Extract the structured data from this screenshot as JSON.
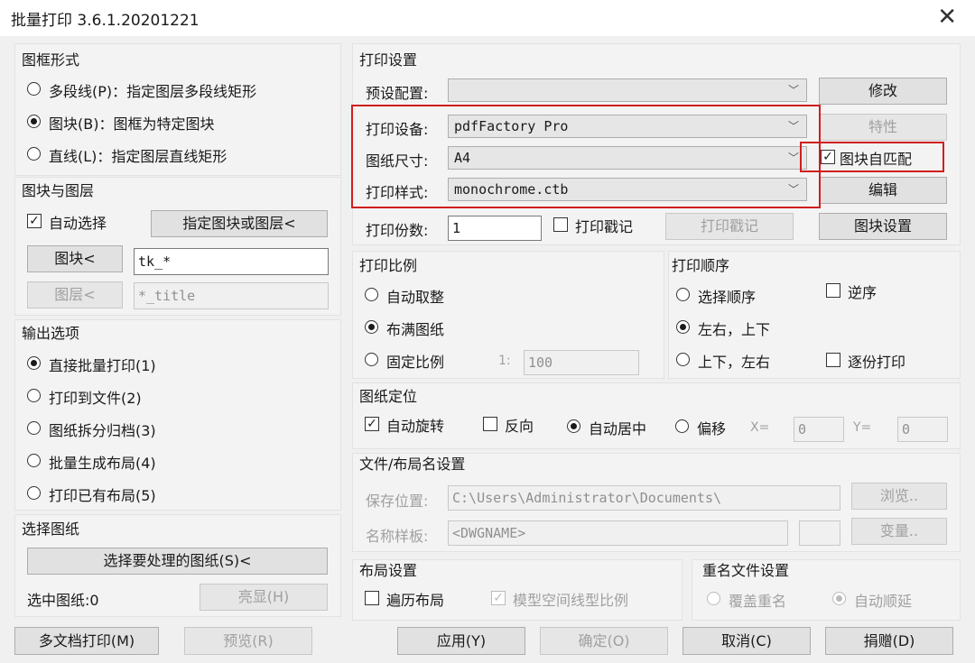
{
  "window": {
    "title": "批量打印 3.6.1.20201221",
    "close": "✕"
  },
  "frame_form": {
    "title": "图框形式",
    "options": [
      "多段线(P)：指定图层多段线矩形",
      "图块(B)：图框为特定图块",
      "直线(L)：指定图层直线矩形"
    ],
    "selected": 1
  },
  "block_layer": {
    "title": "图块与图层",
    "auto_select": "自动选择",
    "specify_btn": "指定图块或图层<",
    "block_btn": "图块<",
    "block_value": "tk_*",
    "layer_btn": "图层<",
    "layer_value": "*_title"
  },
  "output": {
    "title": "输出选项",
    "options": [
      "直接批量打印(1)",
      "打印到文件(2)",
      "图纸拆分归档(3)",
      "批量生成布局(4)",
      "打印已有布局(5)"
    ],
    "selected": 0
  },
  "select_drawing": {
    "title": "选择图纸",
    "select_btn": "选择要处理的图纸(S)<",
    "selected_label": "选中图纸:0",
    "highlight_btn": "亮显(H)"
  },
  "print_settings": {
    "title": "打印设置",
    "preset_label": "预设配置:",
    "preset_value": "",
    "modify_btn": "修改",
    "device_label": "打印设备:",
    "device_value": "pdfFactory Pro",
    "props_btn": "特性",
    "paper_label": "图纸尺寸:",
    "paper_value": "A4",
    "auto_match": "图块自匹配",
    "style_label": "打印样式:",
    "style_value": "monochrome.ctb",
    "edit_btn": "编辑",
    "copies_label": "打印份数:",
    "copies_value": "1",
    "stamp_check": "打印戳记",
    "stamp_btn": "打印戳记",
    "block_settings_btn": "图块设置"
  },
  "scale": {
    "title": "打印比例",
    "options": [
      "自动取整",
      "布满图纸",
      "固定比例"
    ],
    "selected": 1,
    "ratio_prefix": "1:",
    "ratio_value": "100"
  },
  "order": {
    "title": "打印顺序",
    "options": [
      "选择顺序",
      "左右，上下",
      "上下，左右"
    ],
    "selected": 1,
    "reverse": "逆序",
    "collate": "逐份打印"
  },
  "position": {
    "title": "图纸定位",
    "auto_rotate": "自动旋转",
    "reverse": "反向",
    "auto_center": "自动居中",
    "offset": "偏移",
    "x_label": "X=",
    "x_value": "0",
    "y_label": "Y=",
    "y_value": "0"
  },
  "file_naming": {
    "title": "文件/布局名设置",
    "save_label": "保存位置:",
    "save_value": "C:\\Users\\Administrator\\Documents\\",
    "browse_btn": "浏览..",
    "name_label": "名称样板:",
    "name_value": "<DWGNAME>",
    "variable_btn": "变量.."
  },
  "layout": {
    "title": "布局设置",
    "traverse": "遍历布局",
    "model_space": "模型空间线型比例"
  },
  "rename": {
    "title": "重名文件设置",
    "overwrite": "覆盖重名",
    "auto_increment": "自动顺延"
  },
  "bottom": {
    "multi_doc": "多文档打印(M)",
    "preview": "预览(R)",
    "apply": "应用(Y)",
    "ok": "确定(O)",
    "cancel": "取消(C)",
    "donate": "捐赠(D)"
  },
  "accent": {
    "highlight_red": "#d01e1e"
  }
}
